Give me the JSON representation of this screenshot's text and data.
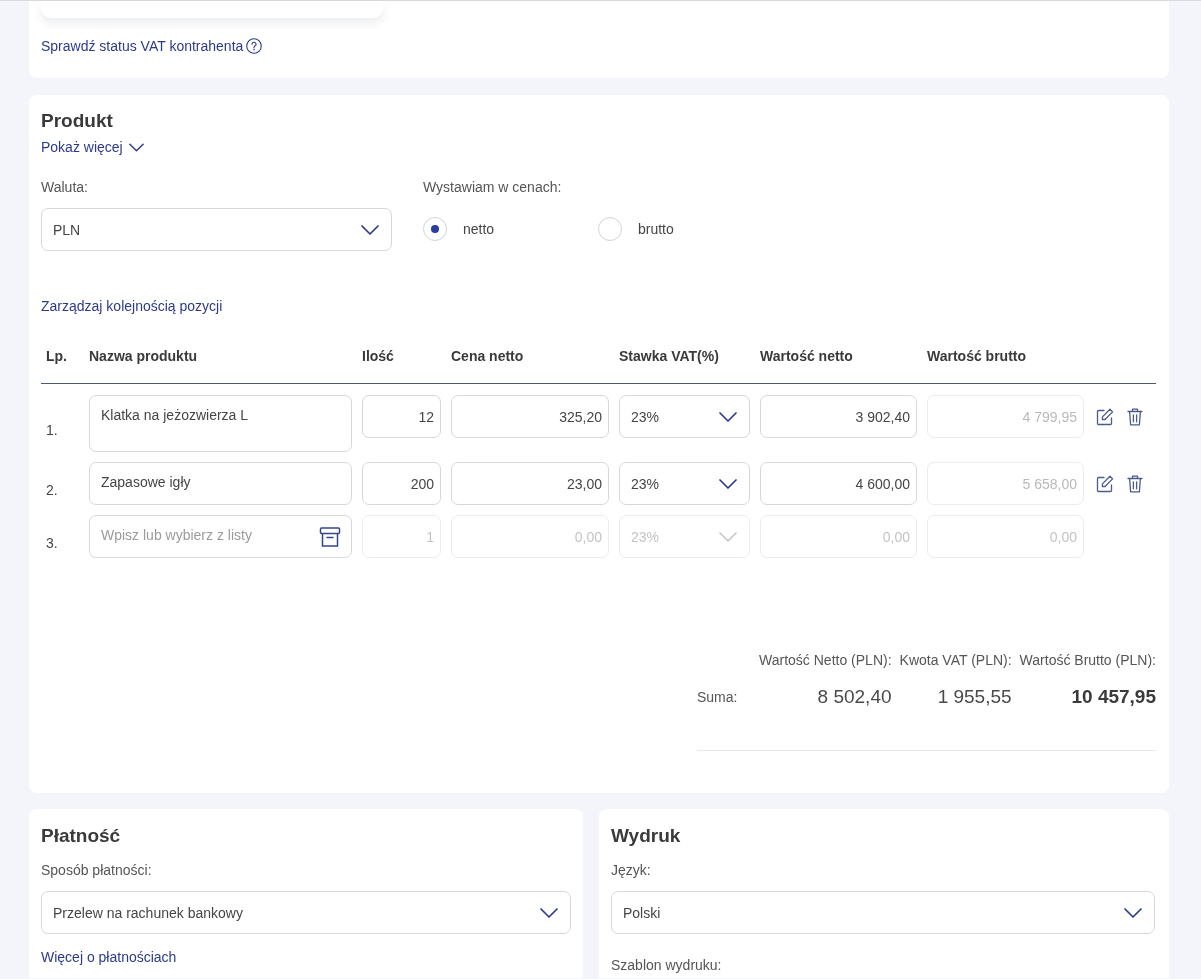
{
  "vat_check": {
    "link": "Sprawdź status VAT kontrahenta"
  },
  "product": {
    "title": "Produkt",
    "show_more": "Pokaż więcej",
    "currency": {
      "label": "Waluta:",
      "value": "PLN"
    },
    "price_mode": {
      "label": "Wystawiam w cenach:",
      "options": [
        {
          "label": "netto",
          "selected": true
        },
        {
          "label": "brutto",
          "selected": false
        }
      ]
    },
    "reorder_link": "Zarządzaj kolejnością pozycji",
    "table": {
      "columns": [
        "Lp.",
        "Nazwa produktu",
        "Ilość",
        "Cena netto",
        "Stawka VAT(%)",
        "Wartość netto",
        "Wartość brutto"
      ],
      "rows": [
        {
          "kind": "item",
          "number": "1.",
          "name": "Klatka na jeżozwierza L",
          "quantity": "12",
          "net_price": "325,20",
          "vat_rate": "23%",
          "net_value": "3 902,40",
          "gross_value": "4 799,95"
        },
        {
          "kind": "item",
          "number": "2.",
          "name": "Zapasowe igły",
          "quantity": "200",
          "net_price": "23,00",
          "vat_rate": "23%",
          "net_value": "4 600,00",
          "gross_value": "5 658,00"
        },
        {
          "kind": "blank",
          "number": "3.",
          "placeholder": "Wpisz lub wybierz z listy",
          "quantity": "1",
          "net_price": "0,00",
          "vat_rate": "23%",
          "net_value": "0,00",
          "gross_value": "0,00"
        }
      ]
    },
    "summary": {
      "sum_label": "Suma:",
      "totals": [
        {
          "label": "Wartość Netto (PLN):",
          "value": "8 502,40"
        },
        {
          "label": "Kwota VAT (PLN):",
          "value": "1 955,55"
        },
        {
          "label": "Wartość Brutto (PLN):",
          "value": "10 457,95"
        }
      ]
    }
  },
  "payment": {
    "title": "Płatność",
    "method": {
      "label": "Sposób płatności:",
      "value": "Przelew na rachunek bankowy"
    },
    "more_link": "Więcej o płatnościach"
  },
  "print": {
    "title": "Wydruk",
    "language": {
      "label": "Język:",
      "value": "Polski"
    },
    "template_label": "Szablon wydruku:"
  }
}
